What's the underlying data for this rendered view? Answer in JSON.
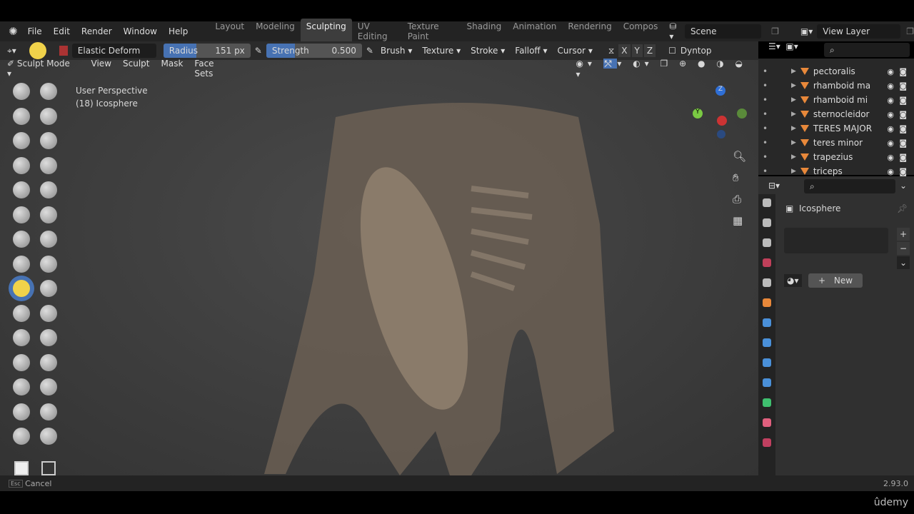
{
  "menus": [
    "File",
    "Edit",
    "Render",
    "Window",
    "Help"
  ],
  "workspaces": [
    "Layout",
    "Modeling",
    "Sculpting",
    "UV Editing",
    "Texture Paint",
    "Shading",
    "Animation",
    "Rendering",
    "Compos"
  ],
  "active_workspace": "Sculpting",
  "scene": "Scene",
  "view_layer": "View Layer",
  "tool_settings": {
    "brush_name": "Elastic Deform",
    "radius_label": "Radius",
    "radius_value": "151 px",
    "strength_label": "Strength",
    "strength_value": "0.500",
    "strength_fraction": 0.5,
    "dropdowns": [
      "Brush",
      "Texture",
      "Stroke",
      "Falloff",
      "Cursor"
    ],
    "axes": [
      "X",
      "Y",
      "Z"
    ],
    "dyntopo": "Dyntop"
  },
  "viewport_header": {
    "mode": "Sculpt Mode",
    "menus": [
      "View",
      "Sculpt",
      "Mask",
      "Face Sets"
    ]
  },
  "viewport": {
    "perspective": "User Perspective",
    "object": "(18) Icosphere",
    "gizmo": {
      "z": "Z",
      "y": "Y"
    }
  },
  "outliner": {
    "items": [
      "pectoralis",
      "rhamboid ma",
      "rhamboid mi",
      "sternocleidor",
      "TERES MAJOR",
      "teres minor",
      "trapezius",
      "triceps"
    ]
  },
  "properties": {
    "object": "Icosphere",
    "new_button": "New"
  },
  "status": {
    "key": "Esc",
    "action": "Cancel",
    "version": "2.93.0"
  },
  "watermark": "ûdemy",
  "colors": {
    "accent": "#4772b3",
    "header": "#232323",
    "panel": "#303030",
    "mesh_icon": "#e8883a"
  }
}
